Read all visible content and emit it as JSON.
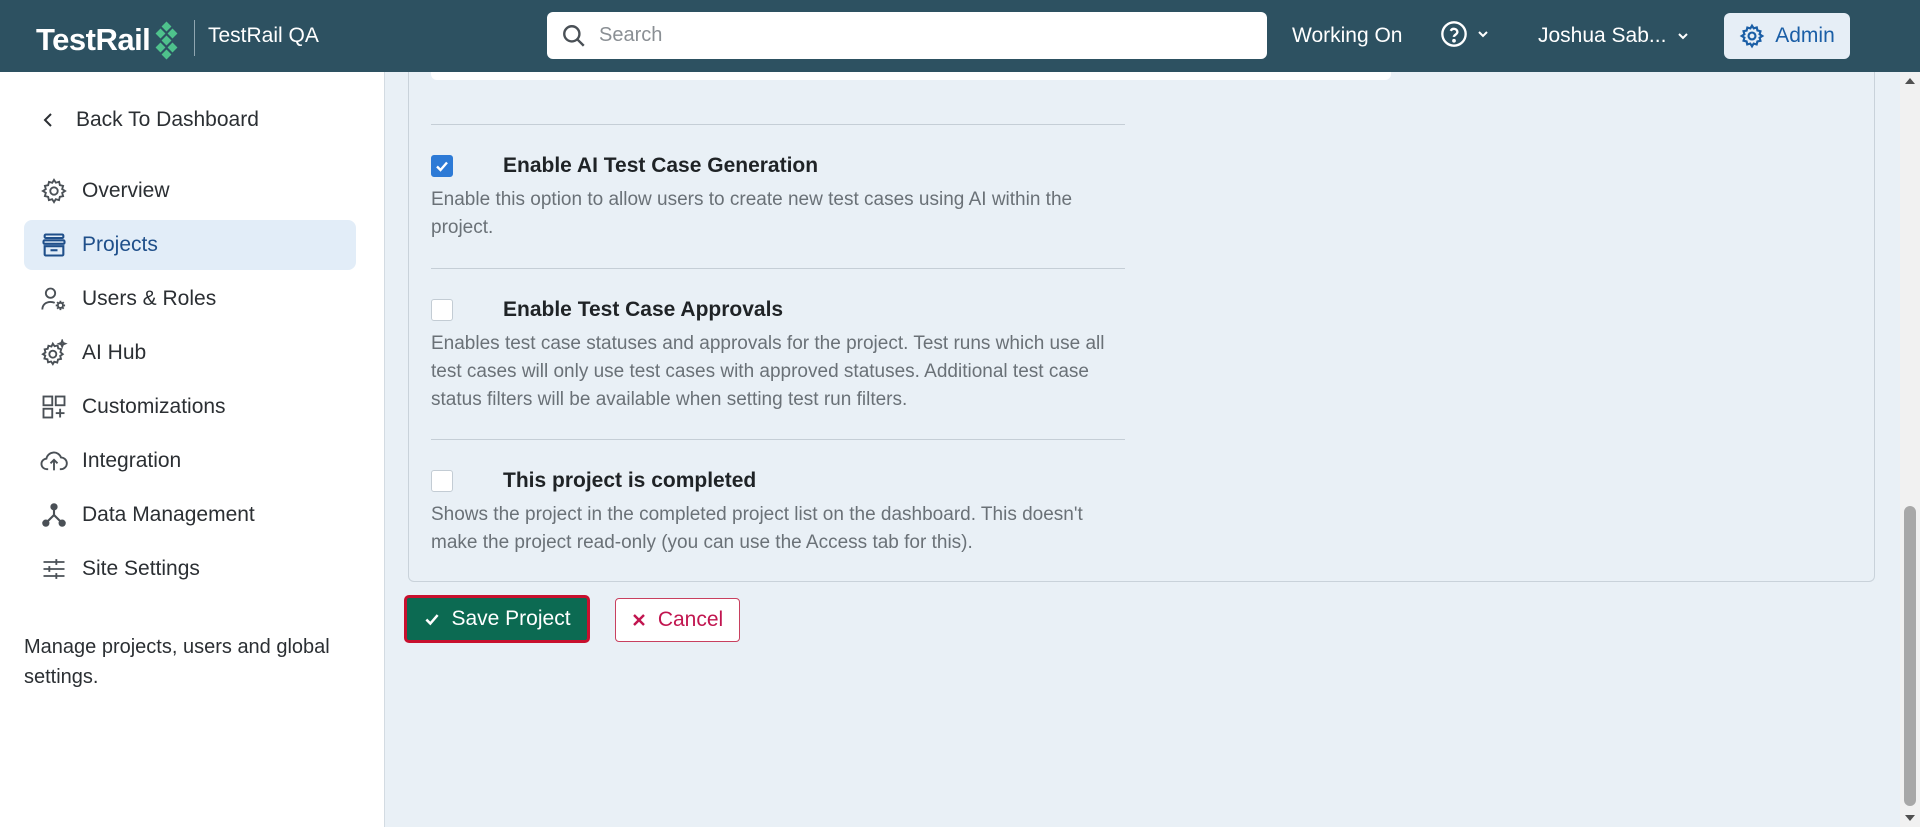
{
  "header": {
    "brand": "TestRail",
    "workspace": "TestRail QA",
    "search_placeholder": "Search",
    "working_on": "Working On",
    "user_name": "Joshua Sab...",
    "admin_label": "Admin"
  },
  "sidebar": {
    "back_label": "Back To Dashboard",
    "items": [
      {
        "label": "Overview",
        "icon": "gear-icon",
        "active": false
      },
      {
        "label": "Projects",
        "icon": "projects-icon",
        "active": true
      },
      {
        "label": "Users & Roles",
        "icon": "users-roles-icon",
        "active": false
      },
      {
        "label": "AI Hub",
        "icon": "ai-hub-icon",
        "active": false
      },
      {
        "label": "Customizations",
        "icon": "customizations-icon",
        "active": false
      },
      {
        "label": "Integration",
        "icon": "cloud-upload-icon",
        "active": false
      },
      {
        "label": "Data Management",
        "icon": "data-management-icon",
        "active": false
      },
      {
        "label": "Site Settings",
        "icon": "sliders-icon",
        "active": false
      }
    ],
    "description": "Manage projects, users and global settings."
  },
  "options": [
    {
      "title": "Enable AI Test Case Generation",
      "checked": true,
      "description": "Enable this option to allow users to create new test cases using AI within the project."
    },
    {
      "title": "Enable Test Case Approvals",
      "checked": false,
      "description": "Enables test case statuses and approvals for the project. Test runs which use all test cases will only use test cases with approved statuses. Additional test case status filters will be available when setting test run filters."
    },
    {
      "title": "This project is completed",
      "checked": false,
      "description": "Shows the project in the completed project list on the dashboard. This doesn't make the project read-only (you can use the Access tab for this)."
    }
  ],
  "actions": {
    "save_label": "Save Project",
    "cancel_label": "Cancel"
  },
  "colors": {
    "header_bg": "#2d5161",
    "save_bg": "#0c6a52",
    "save_outline": "#c8102e",
    "cancel": "#c1154f",
    "checkbox_on": "#2d7ad6"
  }
}
